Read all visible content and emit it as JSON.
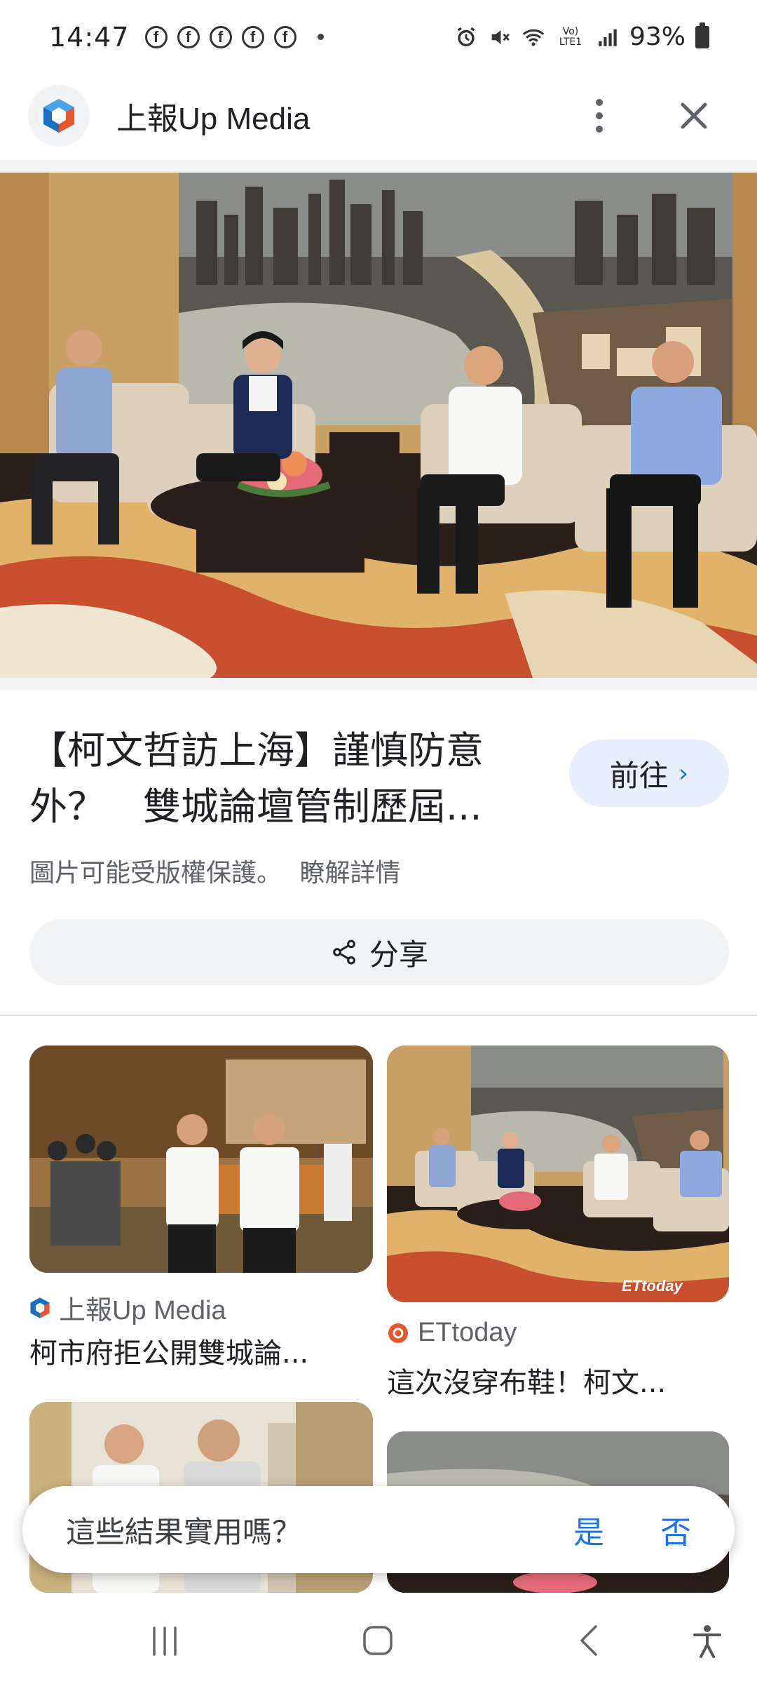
{
  "status_bar": {
    "time": "14:47",
    "notification_icons": [
      "f",
      "f",
      "f",
      "f",
      "f"
    ],
    "battery": "93%",
    "network_label": "Vo) LTE1"
  },
  "header": {
    "site_name": "上報Up Media",
    "more_icon": "more-vert-icon",
    "close_icon": "close-icon"
  },
  "result": {
    "title_line1": "【柯文哲訪上海】謹慎防意",
    "title_line2": "外？　雙城論壇管制歷屆...",
    "goto_label": "前往",
    "copyright_notice": "圖片可能受版權保護。",
    "learn_more": "瞭解詳情",
    "share_label": "分享"
  },
  "related": [
    {
      "source": "上報Up Media",
      "title": "柯市府拒公開雙城論..."
    },
    {
      "source": "ETtoday",
      "title": "這次沒穿布鞋！柯文..."
    }
  ],
  "watermark": "ETtoday",
  "feedback": {
    "question": "這些結果實用嗎？",
    "yes": "是",
    "no": "否"
  },
  "colors": {
    "accent": "#1a73e8",
    "goto_bg": "#e8f0fe",
    "upmedia_blue": "#1b6fc2",
    "ettoday_orange": "#e8542c"
  }
}
